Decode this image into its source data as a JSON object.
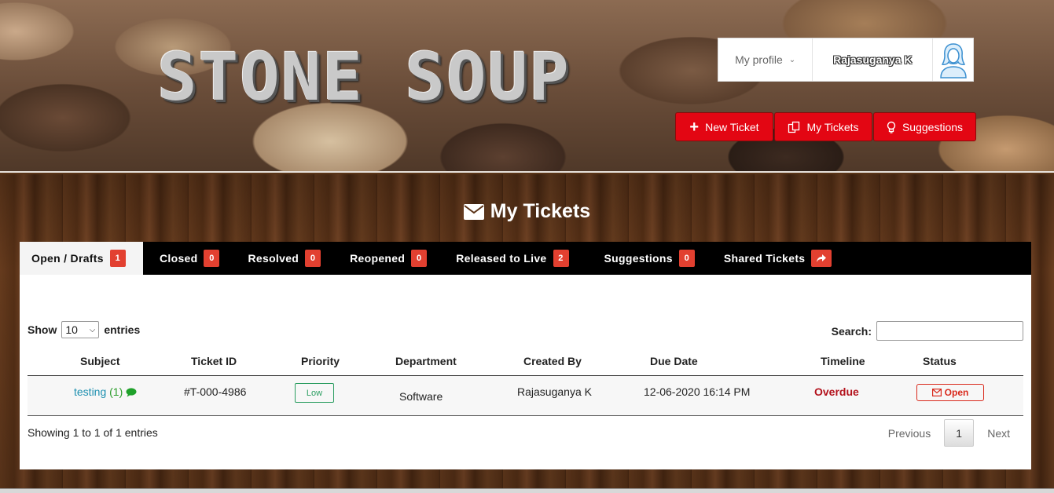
{
  "header": {
    "logo_text": "STONE SOUP",
    "profile_menu_label": "My profile",
    "user_name": "Rajasuganya K",
    "buttons": {
      "new_ticket": "New Ticket",
      "my_tickets": "My Tickets",
      "suggestions": "Suggestions"
    },
    "button_color": "#e30613"
  },
  "page_title": "My Tickets",
  "tabs": [
    {
      "label": "Open / Drafts",
      "count": "1",
      "active": true
    },
    {
      "label": "Closed",
      "count": "0"
    },
    {
      "label": "Resolved",
      "count": "0"
    },
    {
      "label": "Reopened",
      "count": "0"
    },
    {
      "label": "Released to Live",
      "count": "2"
    },
    {
      "label": "Suggestions",
      "count": "0"
    },
    {
      "label": "Shared Tickets",
      "icon": "share-icon"
    }
  ],
  "table_controls": {
    "show_label": "Show",
    "length_value": "10",
    "entries_label": "entries",
    "search_label": "Search:",
    "search_value": ""
  },
  "table": {
    "columns": [
      "Subject",
      "Ticket ID",
      "Priority",
      "Department",
      "Created By",
      "Due Date",
      "Timeline",
      "Status"
    ],
    "rows": [
      {
        "subject": "testing",
        "subject_count": "(1)",
        "ticket_id": "#T-000-4986",
        "priority": "Low",
        "department": "Software",
        "created_by": "Rajasuganya K",
        "due_date": "12-06-2020 16:14 PM",
        "timeline": "Overdue",
        "status": "Open"
      }
    ]
  },
  "footer": {
    "info": "Showing 1 to 1 of 1 entries",
    "previous": "Previous",
    "page": "1",
    "next": "Next"
  }
}
